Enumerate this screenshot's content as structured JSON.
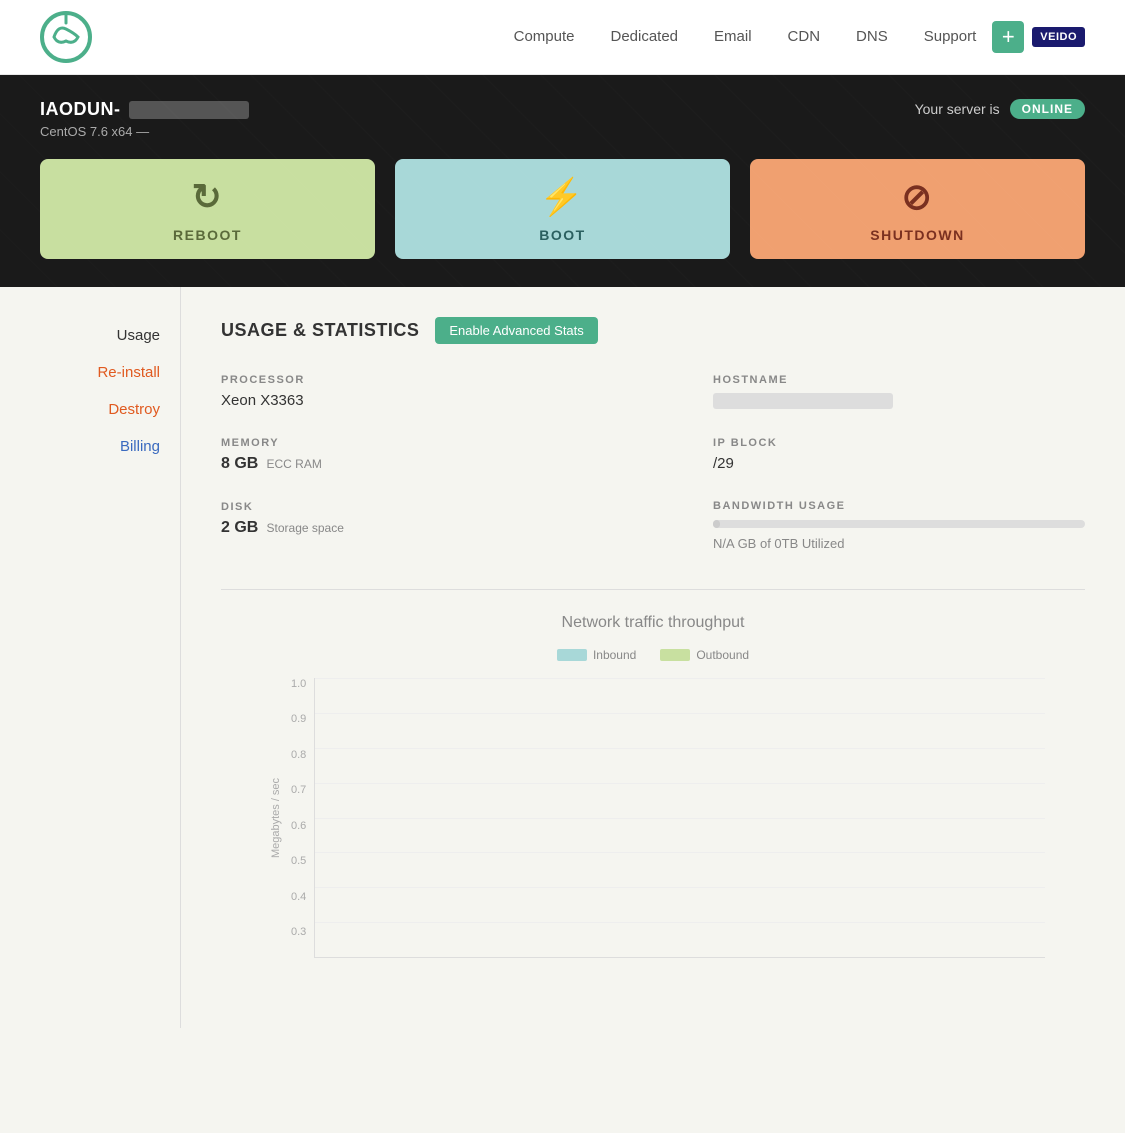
{
  "header": {
    "logo_alt": "Veridian Logo",
    "nav": [
      {
        "label": "Compute",
        "href": "#"
      },
      {
        "label": "Dedicated",
        "href": "#"
      },
      {
        "label": "Email",
        "href": "#"
      },
      {
        "label": "CDN",
        "href": "#"
      },
      {
        "label": "DNS",
        "href": "#"
      },
      {
        "label": "Support",
        "href": "#"
      }
    ],
    "add_button_label": "+",
    "vendor_badge": "VEIDO"
  },
  "server": {
    "name_prefix": "IAODUN-",
    "os": "CentOS 7.6 x64 —",
    "status_label": "Your server is",
    "status_value": "ONLINE"
  },
  "actions": [
    {
      "id": "reboot",
      "label": "REBOOT",
      "icon": "↻"
    },
    {
      "id": "boot",
      "label": "BOOT",
      "icon": "⚡"
    },
    {
      "id": "shutdown",
      "label": "SHUTDOWN",
      "icon": "⊘"
    }
  ],
  "sidebar": {
    "items": [
      {
        "label": "Usage",
        "type": "active"
      },
      {
        "label": "Re-install",
        "type": "danger"
      },
      {
        "label": "Destroy",
        "type": "danger"
      },
      {
        "label": "Billing",
        "type": "billing"
      }
    ]
  },
  "stats": {
    "section_title": "USAGE & STATISTICS",
    "enable_btn": "Enable Advanced Stats",
    "processor_label": "PROCESSOR",
    "processor_value": "Xeon X3363",
    "memory_label": "MEMORY",
    "memory_value": "8 GB",
    "memory_sub": "ECC RAM",
    "disk_label": "DISK",
    "disk_value": "2 GB",
    "disk_sub": "Storage space",
    "hostname_label": "HOSTNAME",
    "ip_block_label": "IP BLOCK",
    "ip_block_value": "/29",
    "bandwidth_label": "BANDWIDTH USAGE",
    "bandwidth_text": "N/A GB of 0TB Utilized"
  },
  "chart": {
    "title": "Network traffic throughput",
    "legend_inbound": "Inbound",
    "legend_outbound": "Outbound",
    "y_axis_label": "Megabytes / sec",
    "y_values": [
      "1.0",
      "0.9",
      "0.8",
      "0.7",
      "0.6",
      "0.5",
      "0.4",
      "0.3"
    ],
    "colors": {
      "inbound": "#a8d8d8",
      "outbound": "#c8e0a0"
    }
  }
}
